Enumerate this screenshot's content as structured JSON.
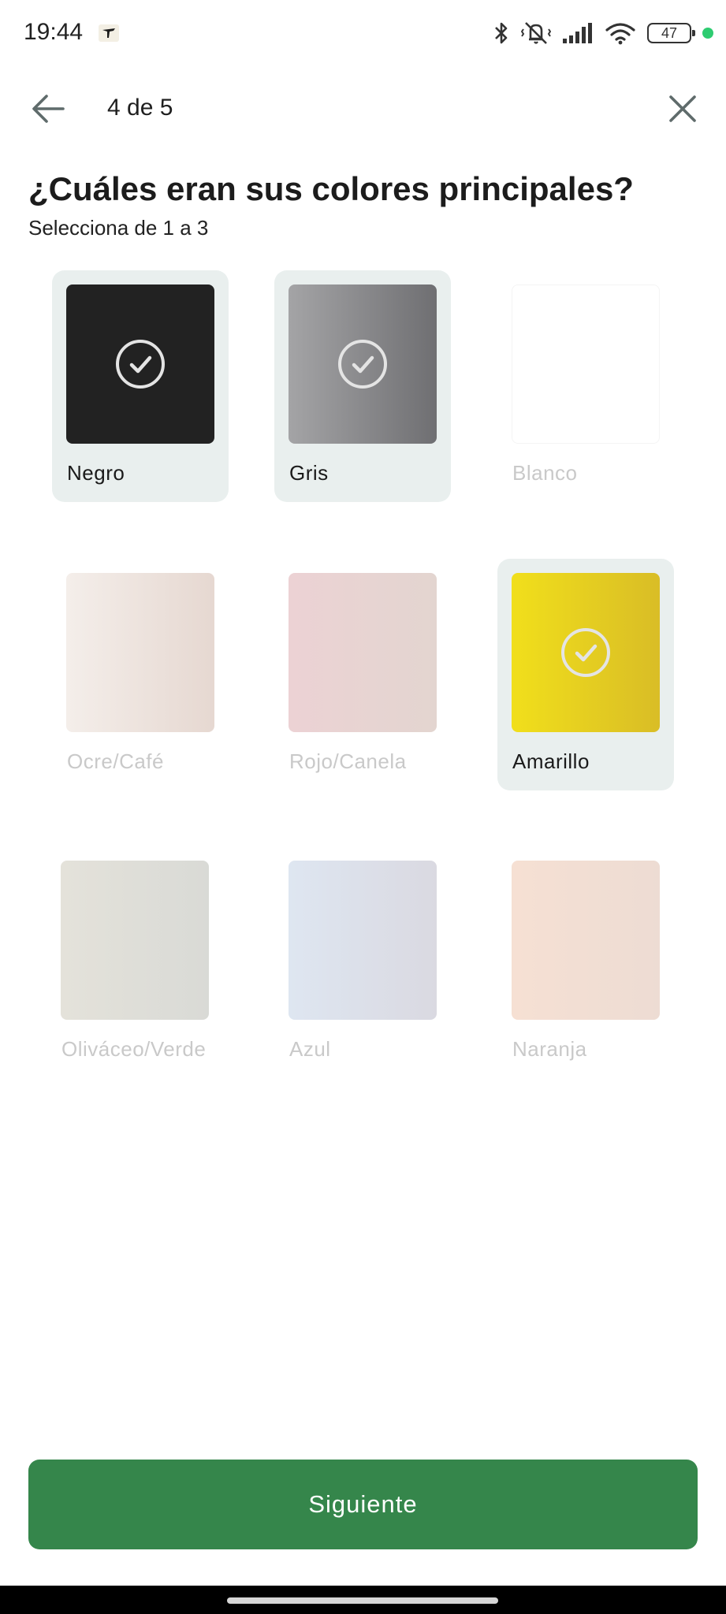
{
  "status_bar": {
    "time": "19:44",
    "battery": "47",
    "icons": [
      "app-notification-icon",
      "bluetooth-icon",
      "mute-vibrate-icon",
      "signal-icon",
      "wifi-icon",
      "battery-icon",
      "active-dot-icon"
    ]
  },
  "nav": {
    "step": "4 de 5",
    "back_icon": "arrow-left-icon",
    "close_icon": "close-icon"
  },
  "question": {
    "title": "¿Cuáles eran sus colores principales?",
    "subtitle": "Selecciona de 1 a 3"
  },
  "options": [
    {
      "label": "Negro",
      "selected": true,
      "from": "#222222",
      "to": "#222222"
    },
    {
      "label": "Gris",
      "selected": true,
      "from": "#a4a4a6",
      "to": "#6f6f72"
    },
    {
      "label": "Blanco",
      "selected": false,
      "from": "#ffffff",
      "to": "#ffffff"
    },
    {
      "label": "Ocre/Café",
      "selected": false,
      "from": "#f4eeea",
      "to": "#e6d8d1"
    },
    {
      "label": "Rojo/Canela",
      "selected": false,
      "from": "#ecd2d4",
      "to": "#e3d5d0"
    },
    {
      "label": "Amarillo",
      "selected": true,
      "from": "#f1df1b",
      "to": "#d9bd26"
    },
    {
      "label": "Oliváceo/Verde",
      "selected": false,
      "from": "#e4e2da",
      "to": "#d9dad6"
    },
    {
      "label": "Azul",
      "selected": false,
      "from": "#dee6f1",
      "to": "#dad9e1"
    },
    {
      "label": "Naranja",
      "selected": false,
      "from": "#f6e0d3",
      "to": "#eddcd3"
    }
  ],
  "next_button": "Siguiente",
  "colors": {
    "primary": "#35864b",
    "selected_bg": "#e9efee"
  }
}
